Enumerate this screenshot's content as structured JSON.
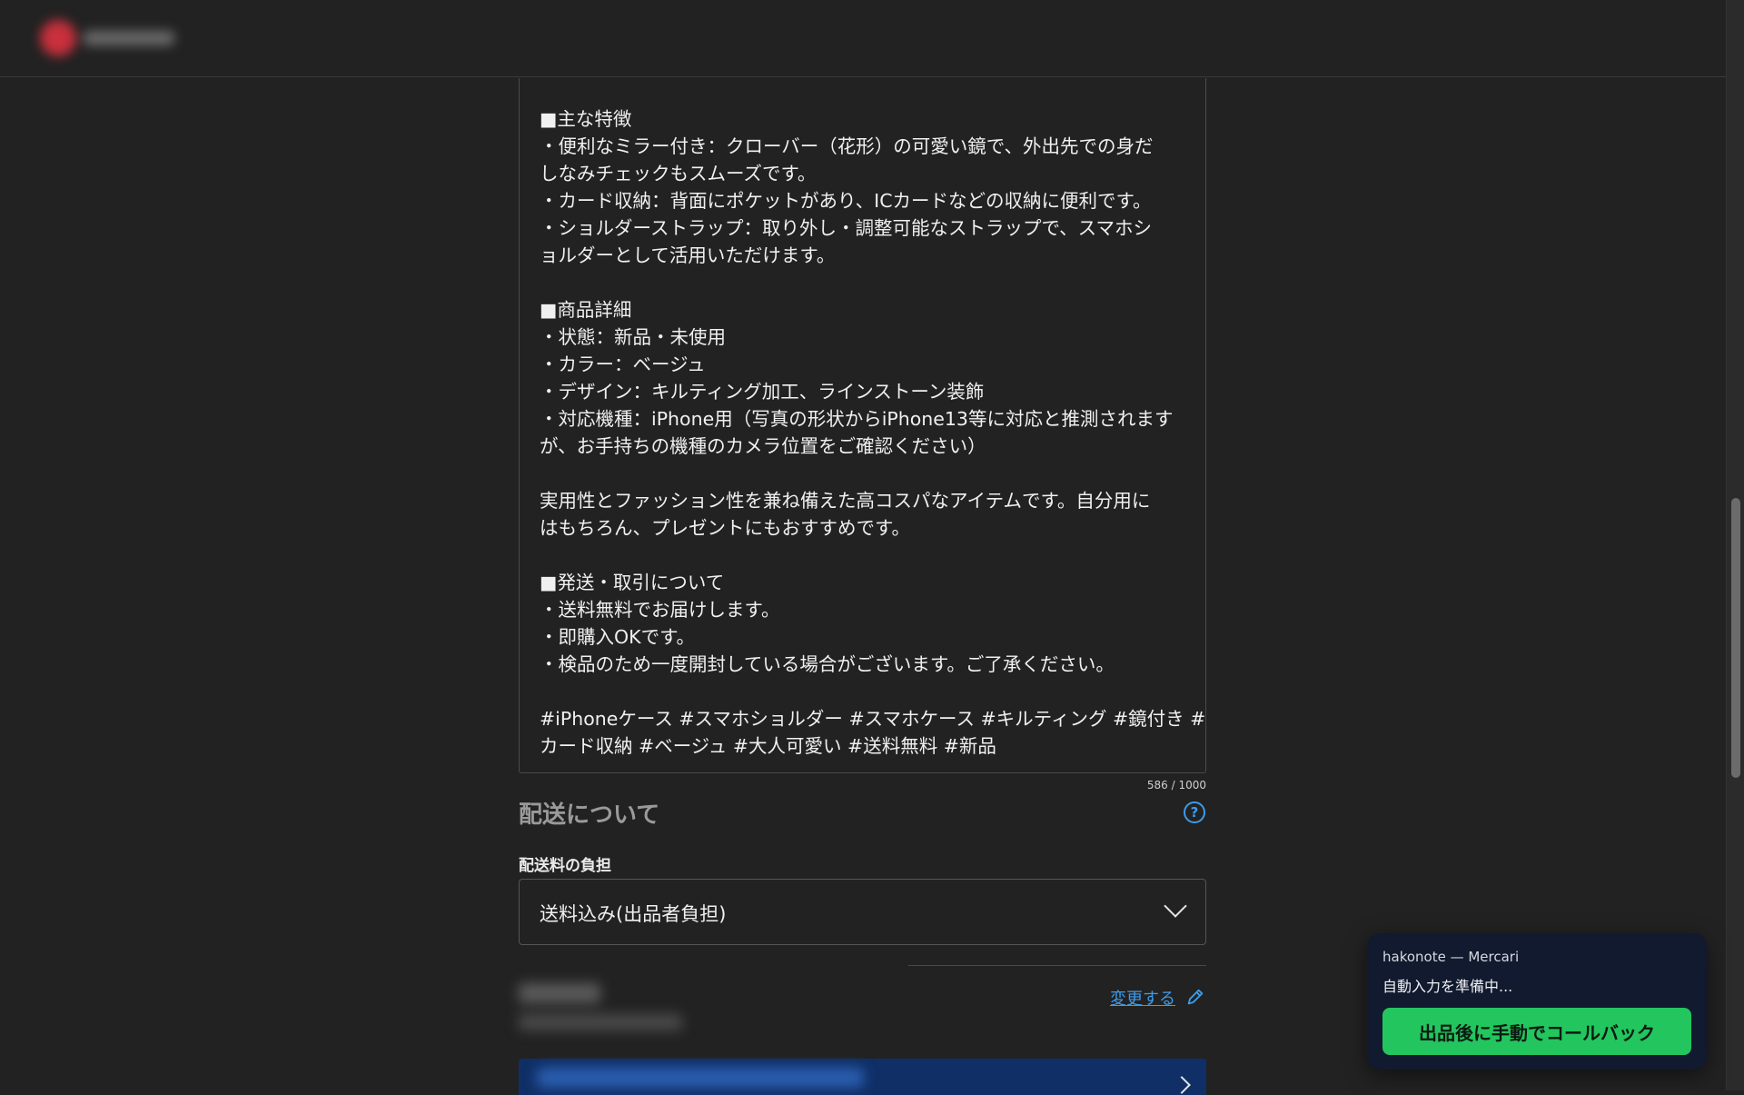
{
  "header": {
    "logo_name": "mercari-logo-blurred"
  },
  "description": {
    "lines": [
      "■主な特徴",
      "・便利なミラー付き：クローバー（花形）の可愛い鏡で、外出先での身だ",
      "しなみチェックもスムーズです。",
      "・カード収納：背面にポケットがあり、ICカードなどの収納に便利です。",
      "・ショルダーストラップ：取り外し・調整可能なストラップで、スマホシ",
      "ョルダーとして活用いただけます。",
      "",
      "■商品詳細",
      "・状態：新品・未使用",
      "・カラー：ベージュ",
      "・デザイン：キルティング加工、ラインストーン装飾",
      "・対応機種：iPhone用（写真の形状からiPhone13等に対応と推測されます",
      "が、お手持ちの機種のカメラ位置をご確認ください）",
      "",
      "実用性とファッション性を兼ね備えた高コスパなアイテムです。自分用に",
      "はもちろん、プレゼントにもおすすめです。",
      "",
      "■発送・取引について",
      "・送料無料でお届けします。",
      "・即購入OKです。",
      "・検品のため一度開封している場合がございます。ご了承ください。",
      "",
      "#iPhoneケース #スマホショルダー #スマホケース #キルティング #鏡付き #",
      "カード収納 #ベージュ #大人可愛い #送料無料 #新品"
    ],
    "char_count": "586 / 1000"
  },
  "shipping": {
    "section_title": "配送について",
    "help_icon_glyph": "?",
    "fee_label": "配送料の負担",
    "fee_value": "送料込み(出品者負担)",
    "change_link": "変更する"
  },
  "popup": {
    "title": "hakonote — Mercari",
    "status": "自動入力を準備中...",
    "button_label": "出品後に手動でコールバック",
    "button_color": "#22c55e"
  },
  "colors": {
    "background": "#222222",
    "link": "#3d9be9",
    "popup_bg": "#111a2e"
  }
}
